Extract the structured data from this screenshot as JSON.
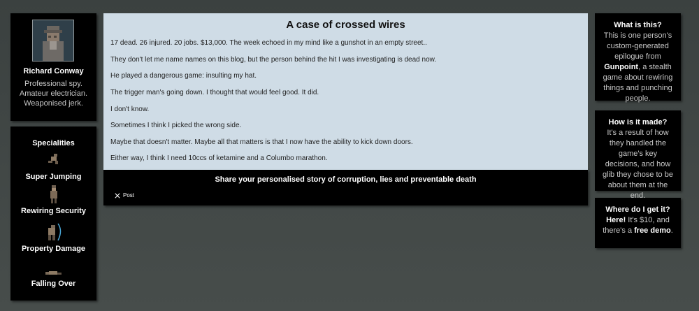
{
  "profile": {
    "name": "Richard Conway",
    "desc": [
      "Professional spy.",
      "Amateur electrician.",
      "Weaponised jerk."
    ]
  },
  "specialities": {
    "title": "Specialities",
    "items": [
      {
        "label": "Super Jumping",
        "icon": "jumping-spy-icon"
      },
      {
        "label": "Rewiring Security",
        "icon": "standing-spy-icon"
      },
      {
        "label": "Property Damage",
        "icon": "crossed-wires-spy-icon"
      },
      {
        "label": "Falling Over",
        "icon": "fallen-spy-icon"
      }
    ]
  },
  "main": {
    "title": "A case of crossed wires",
    "paragraphs": [
      "17 dead. 26 injured. 20 jobs. $13,000. The week echoed in my mind like a gunshot in an empty street..",
      "They don't let me name names on this blog, but the person behind the hit I was investigating is dead now.",
      "He played a dangerous game: insulting my hat.",
      "The trigger man's going down. I thought that would feel good. It did.",
      "I don't know.",
      "Sometimes I think I picked the wrong side.",
      "Maybe that doesn't matter. Maybe all that matters is that I now have the ability to kick down doors.",
      "Either way, I think I need 10ccs of ketamine and a Columbo marathon."
    ]
  },
  "share": {
    "headline": "Share your personalised story of corruption, lies and preventable death",
    "post_label": "Post"
  },
  "what": {
    "title": "What is this?",
    "body_pre": "This is one person's custom-generated epilogue from ",
    "link": "Gunpoint",
    "body_post": ", a stealth game about rewiring things and punching people."
  },
  "how": {
    "title": "How is it made?",
    "body": "It's a result of how they handled the game's key decisions, and how glib they chose to be about them at the end."
  },
  "where": {
    "title": "Where do I get it?",
    "link": "Here!",
    "body_mid": " It's $10, and there's a ",
    "link2": "free demo",
    "body_end": "."
  }
}
